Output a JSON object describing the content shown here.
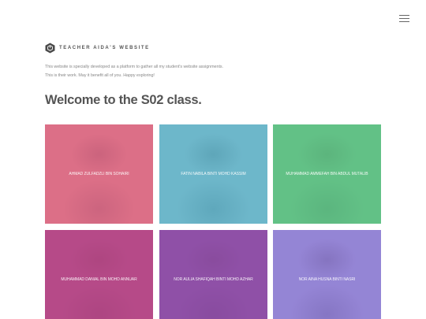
{
  "header": {
    "menu_icon": "hamburger-menu-icon",
    "brand_icon": "hexagon-logo-icon",
    "brand_title": "TEACHER AIDA'S WEBSITE"
  },
  "intro": {
    "line1": "This website is specially developed as a platform to gather all my student's website assignments.",
    "line2": "This is their work. May it benefit all of you. Happy exploring!"
  },
  "heading": "Welcome to the S02 class.",
  "students": [
    {
      "name": "AHMAD ZULFADZLI BIN SOHAIRI",
      "tint": "#e2688e",
      "bg": "#c98a6e"
    },
    {
      "name": "FATIN NABILA BINTI MOHD KASSIM",
      "tint": "#58b9d3",
      "bg": "#b8b0a8"
    },
    {
      "name": "MUHAMMAD AMMEFAH BIN ABDUL MUTALIB",
      "tint": "#5fcf8e",
      "bg": "#6f8c6a"
    },
    {
      "name": "MUHAMMAD DANIAL BIN MOHD ANNUAR",
      "tint": "#c64a95",
      "bg": "#7a4a5c"
    },
    {
      "name": "NOR AULIA SHAFIQAH BINTI MOHD AZHAR",
      "tint": "#9a52b8",
      "bg": "#6a4a6a"
    },
    {
      "name": "NOR AINA HUSNA BINTI NASRI",
      "tint": "#8a78d8",
      "bg": "#b8b0c8"
    }
  ]
}
